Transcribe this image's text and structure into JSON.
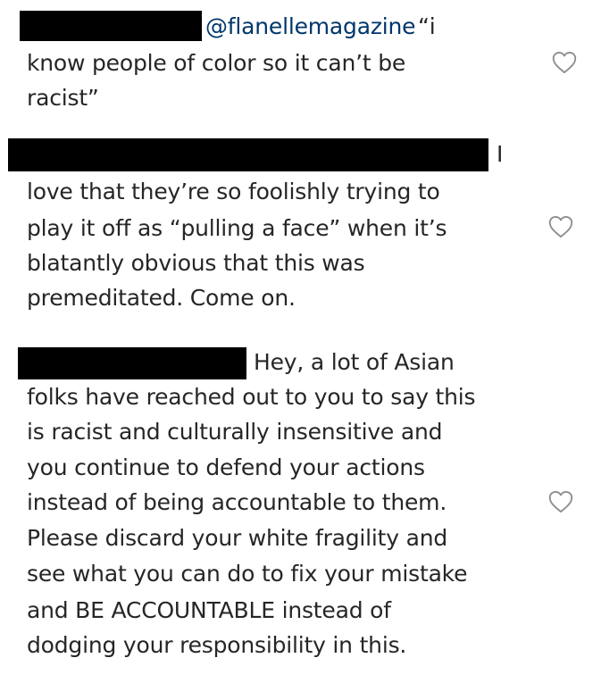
{
  "comments": [
    {
      "mention": "@flanellemagazine",
      "lines": [
        "“i",
        "know people of color so it can’t be",
        "racist”"
      ],
      "liked": false
    },
    {
      "lines": [
        "I",
        "love that they’re so foolishly trying to",
        "play it off as “pulling a face” when it’s",
        "blatantly obvious that this was",
        "premeditated. Come on."
      ],
      "liked": false
    },
    {
      "lines": [
        "Hey, a lot of Asian",
        "folks have reached out to you to say this",
        "is racist and culturally insensitive and",
        "you continue to defend your actions",
        "instead of being accountable to them.",
        "Please discard your white fragility and",
        "see what you can do to fix your mistake",
        "and BE ACCOUNTABLE instead of",
        "dodging your responsibility in this."
      ],
      "liked": false
    }
  ],
  "icons": {
    "like": "heart-outline-icon",
    "heart_color": "#8e8e8e"
  },
  "colors": {
    "text": "#262626",
    "mention": "#00376b",
    "redaction": "#000000",
    "background": "#ffffff"
  }
}
